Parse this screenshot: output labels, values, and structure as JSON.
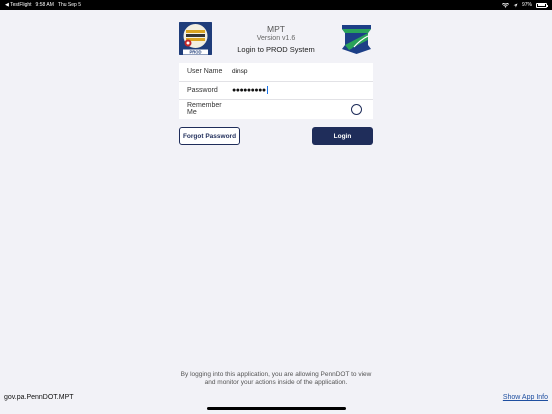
{
  "status_bar": {
    "back_app": "◀ TestFlight",
    "time": "9:58 AM",
    "date": "Thu Sep 5",
    "battery": "97%"
  },
  "header": {
    "app_name": "MPT",
    "version": "Version v1.6",
    "login_system": "Login to PROD System",
    "left_logo_text": "PROD"
  },
  "form": {
    "username_label": "User Name",
    "username_value": "dinsp",
    "password_label": "Password",
    "password_value": "●●●●●●●●●",
    "remember_label": "Remember Me"
  },
  "buttons": {
    "forgot_password": "Forgot Password",
    "login": "Login"
  },
  "footer": {
    "disclaimer": "By logging into this application, you are allowing PennDOT to view and monitor your actions inside of the application.",
    "bundle_id": "gov.pa.PennDOT.MPT",
    "show_app_info": "Show App Info"
  },
  "colors": {
    "primary": "#1f2d5a",
    "background": "#f2f2f7",
    "link": "#1f4fa0"
  }
}
